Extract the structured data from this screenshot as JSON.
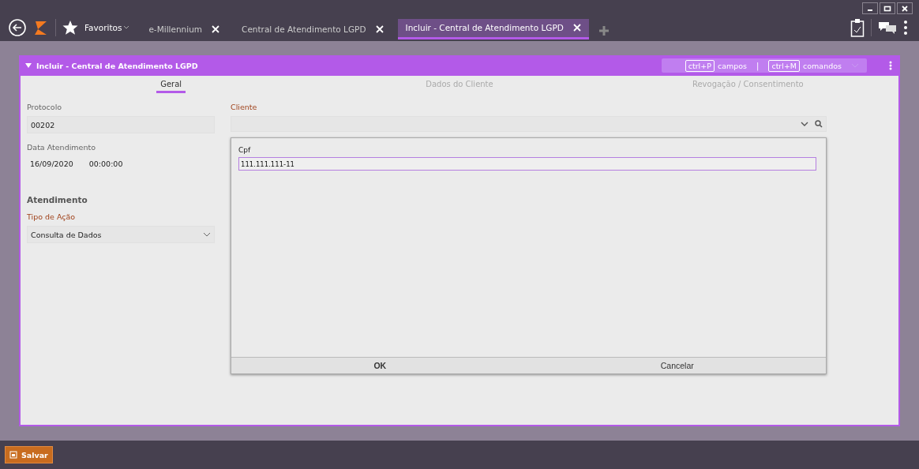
{
  "topbar": {
    "favorites": "Favoritos",
    "tabs": [
      {
        "label": "e-Millennium",
        "selected": false
      },
      {
        "label": "Central de Atendimento LGPD",
        "selected": false
      },
      {
        "label": "Incluir - Central de Atendimento LGPD",
        "selected": true
      }
    ]
  },
  "panel": {
    "title": "Incluir - Central de Atendimento LGPD",
    "shortcuts": [
      {
        "key": "ctrl+P",
        "label": "campos"
      },
      {
        "key": "ctrl+M",
        "label": "comandos"
      }
    ],
    "separator": "|",
    "tabs": [
      {
        "label": "Geral",
        "selected": true
      },
      {
        "label": "Dados do Cliente",
        "selected": false
      },
      {
        "label": "Revogação / Consentimento",
        "selected": false
      }
    ]
  },
  "form": {
    "protocolo_label": "Protocolo",
    "protocolo": "00202",
    "data_label": "Data Atendimento",
    "date": "16/09/2020",
    "time": "00:00:00",
    "section": "Atendimento",
    "tipo_label": "Tipo de Ação",
    "tipo": "Consulta de Dados",
    "cliente_label": "Cliente"
  },
  "popup": {
    "field_label": "Cpf",
    "field_value": "111.111.111-11",
    "buttons": [
      "OK",
      "Cancelar"
    ]
  },
  "footer": {
    "save": "Salvar"
  }
}
